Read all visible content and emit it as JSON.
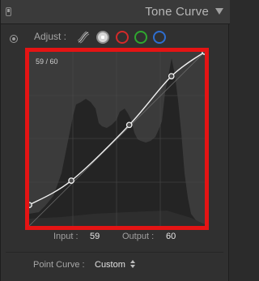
{
  "panel": {
    "title": "Tone Curve"
  },
  "adjust": {
    "label": "Adjust :",
    "channels": [
      "parametric",
      "rgb",
      "red",
      "green",
      "blue"
    ],
    "selected": "rgb",
    "colors": {
      "red": "#d42a2a",
      "green": "#2fa62f",
      "blue": "#2e6ed0"
    }
  },
  "curve": {
    "readout": "59 / 60",
    "highlight_color": "#e41414",
    "points": [
      [
        0,
        12
      ],
      [
        24,
        26
      ],
      [
        57,
        58
      ],
      [
        81,
        86
      ],
      [
        100,
        100
      ]
    ]
  },
  "io": {
    "input_label": "Input :",
    "input_value": "59",
    "output_label": "Output :",
    "output_value": "60"
  },
  "point_curve": {
    "label": "Point Curve :",
    "value": "Custom"
  }
}
